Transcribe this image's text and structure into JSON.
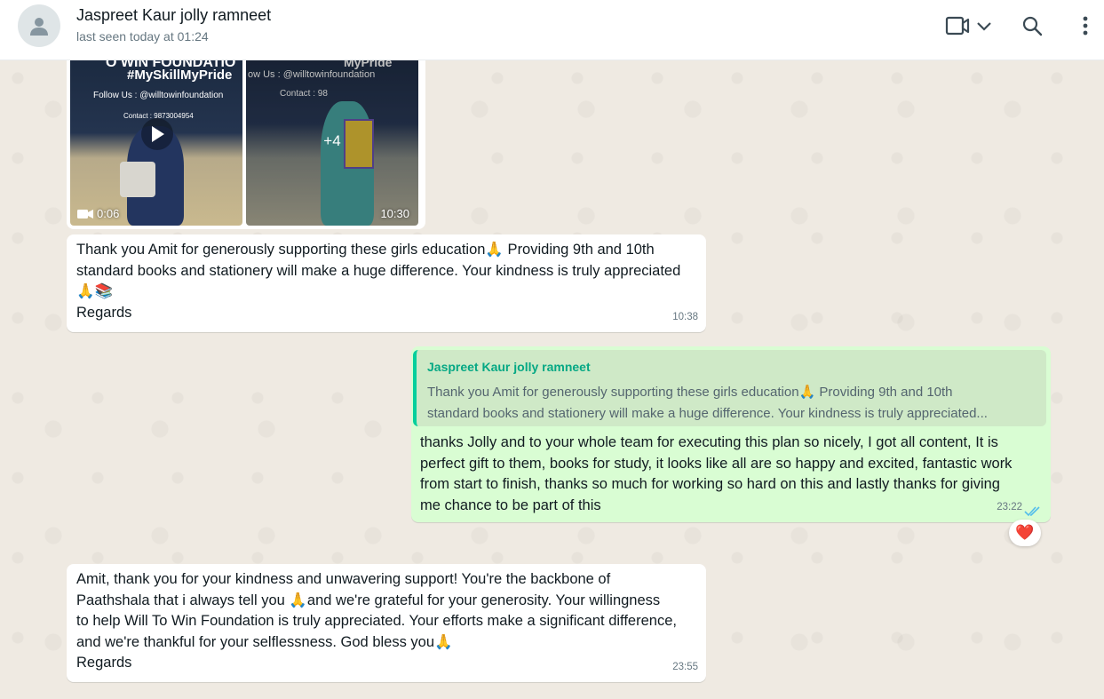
{
  "header": {
    "contact_name": "Jaspreet Kaur jolly ramneet",
    "status": "last seen today at 01:24",
    "icons": [
      "avatar-default-icon",
      "video-call-icon",
      "chevron-down-icon",
      "search-icon",
      "menu-dots-icon"
    ]
  },
  "media": {
    "thumb1": {
      "banner_top": "O WIN FOUNDATIO",
      "hashtag": "#MySkillMyPride",
      "follow": "Follow Us : @willtowinfoundation",
      "contact": "Contact : 9873004954",
      "video_duration": "0:06"
    },
    "thumb2": {
      "banner_top": "MyPride",
      "follow": "ow Us : @willtowinfoundation",
      "contact": "Contact : 98",
      "more_count": "+4"
    },
    "time": "10:30"
  },
  "messages": [
    {
      "direction": "in",
      "text": "Thank you Amit for generously supporting these girls education🙏 Providing 9th and 10th\nstandard books and stationery will make a huge difference. Your kindness is truly appreciated\n🙏📚\nRegards",
      "time": "10:38"
    },
    {
      "direction": "out",
      "quote_author": "Jaspreet Kaur jolly ramneet",
      "quote_text": "Thank you Amit for generously supporting these girls education🙏 Providing 9th and 10th\nstandard books and stationery will make a huge difference. Your kindness is truly appreciated...",
      "text": "thanks Jolly and to your whole team for executing this plan so nicely, I got all content, It is\nperfect gift to them, books for study, it looks like all are so happy and excited, fantastic work\nfrom start to finish, thanks so much for working so hard on this and lastly thanks for giving\nme chance to be part of this",
      "time": "23:22",
      "status": "read-double-check-icon",
      "reaction": "❤️"
    },
    {
      "direction": "in",
      "text": "Amit, thank you for your kindness and unwavering support! You're the backbone of\nPaathshala that i always tell you 🙏and we're grateful for your generosity. Your willingness\nto help Will To Win Foundation is truly appreciated. Your efforts make a significant difference,\nand we're thankful for your selflessness. God bless you🙏\nRegards",
      "time": "23:55"
    }
  ],
  "colors": {
    "chat_bg": "#efeae2",
    "incoming_bubble": "#ffffff",
    "outgoing_bubble": "#d9fdd3",
    "quote_accent": "#06cf9c",
    "read_tick": "#53bdeb"
  }
}
